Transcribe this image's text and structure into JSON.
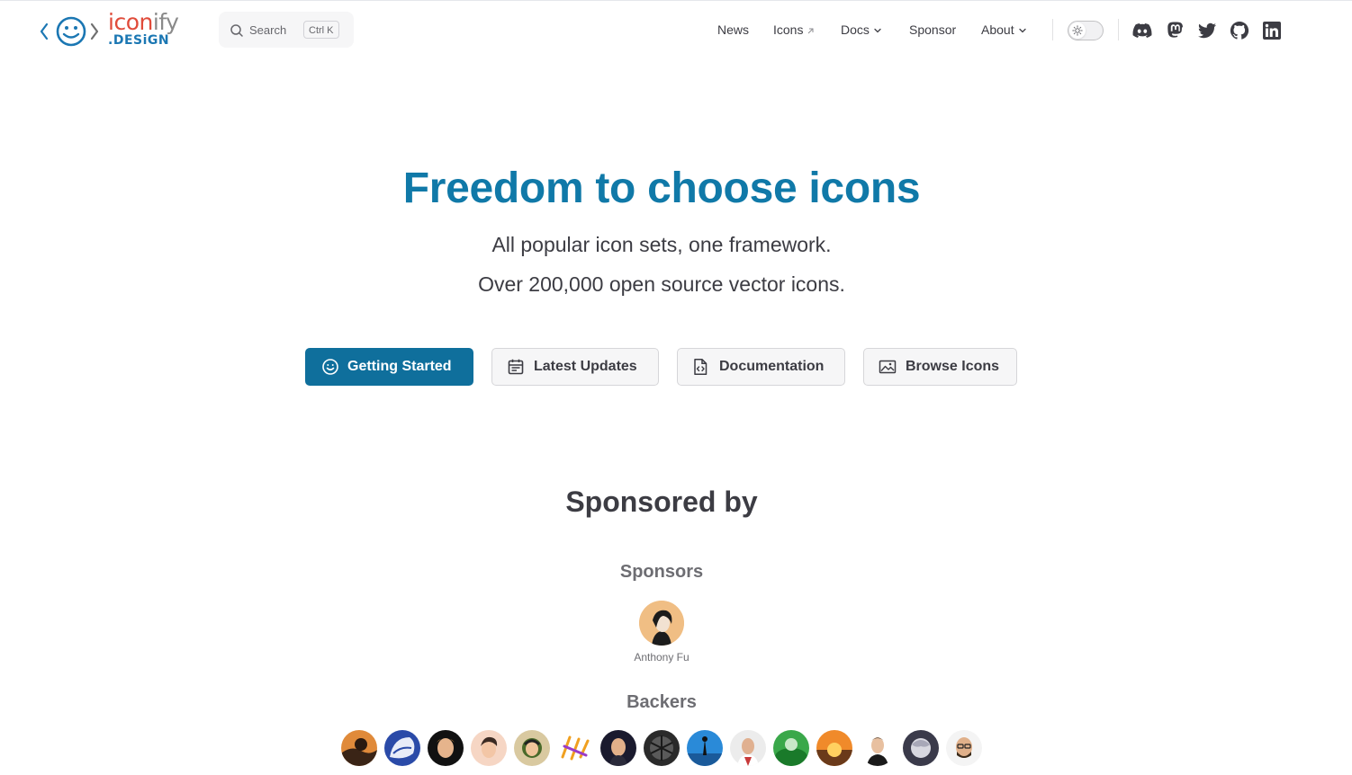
{
  "brand": {
    "word_part1": "icon",
    "word_part2": "ify",
    "tld": ".DESiGN",
    "colors": {
      "red": "#e04b3a",
      "gray": "#8a8a8a",
      "blue": "#1b77b3"
    }
  },
  "search": {
    "label": "Search",
    "shortcut": "Ctrl K"
  },
  "nav": {
    "items": [
      {
        "label": "News",
        "icon": ""
      },
      {
        "label": "Icons",
        "icon": "external-link-icon"
      },
      {
        "label": "Docs",
        "icon": "chevron-down-icon"
      },
      {
        "label": "Sponsor",
        "icon": ""
      },
      {
        "label": "About",
        "icon": "chevron-down-icon"
      }
    ],
    "appearance_toggle": "sun-icon",
    "social": [
      "discord-icon",
      "mastodon-icon",
      "twitter-icon",
      "github-icon",
      "linkedin-icon"
    ]
  },
  "hero": {
    "title": "Freedom to choose icons",
    "line1": "All popular icon sets, one framework.",
    "line2": "Over 200,000 open source vector icons.",
    "accent_color": "#1079a8"
  },
  "actions": [
    {
      "label": "Getting Started",
      "icon": "smile-icon",
      "style": "primary"
    },
    {
      "label": "Latest Updates",
      "icon": "calendar-icon",
      "style": "secondary"
    },
    {
      "label": "Documentation",
      "icon": "code-file-icon",
      "style": "secondary"
    },
    {
      "label": "Browse Icons",
      "icon": "image-icon",
      "style": "secondary"
    }
  ],
  "sponsors": {
    "title": "Sponsored by",
    "sponsors_heading": "Sponsors",
    "sponsor_name": "Anthony Fu",
    "backers_heading": "Backers",
    "backer_count_visible": 15
  }
}
